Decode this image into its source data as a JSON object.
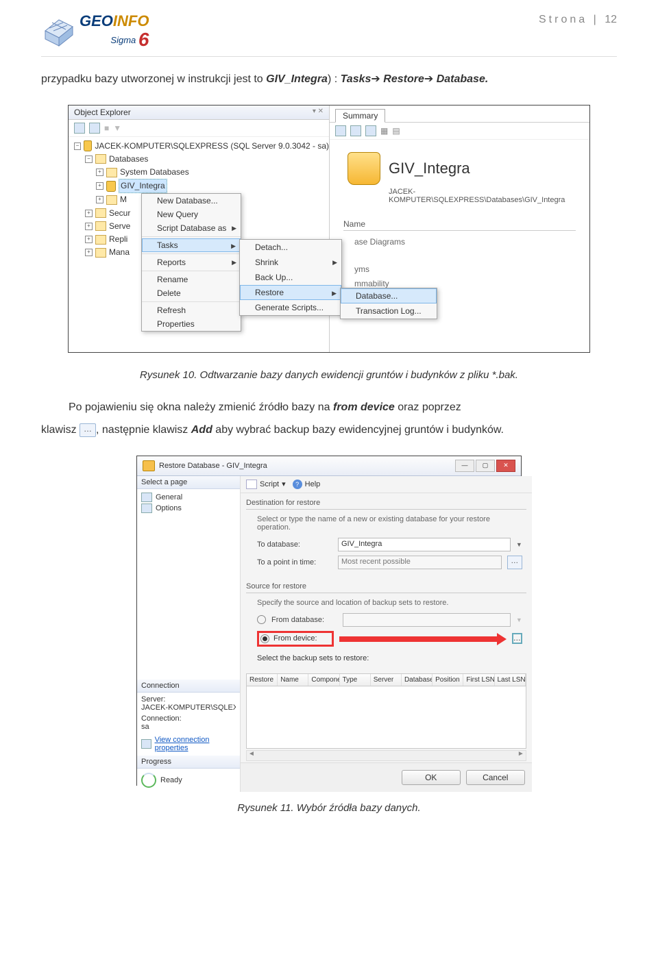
{
  "header": {
    "logo_geo": "GEO",
    "logo_info": "INFO",
    "logo_sigma": "Sigma",
    "logo_six": "6",
    "page_label": "Strona",
    "page_number": "12"
  },
  "para1_a": "przypadku bazy utworzonej w instrukcji jest to ",
  "para1_b": "GIV_Integra",
  "para1_c": ") : ",
  "para1_tasks": "Tasks",
  "para1_restore": "Restore",
  "para1_db": "Database.",
  "fig1": {
    "oe_title": "Object Explorer",
    "pin": "▾ ✕",
    "server": "JACEK-KOMPUTER\\SQLEXPRESS (SQL Server 9.0.3042 - sa)",
    "databases": "Databases",
    "sys_db": "System Databases",
    "giv": "GIV_Integra",
    "folders": [
      "M",
      "Secur",
      "Serve",
      "Repli",
      "Mana"
    ],
    "menu1": [
      "New Database...",
      "New Query",
      "Script Database as",
      "Tasks",
      "Reports",
      "Rename",
      "Delete",
      "Refresh",
      "Properties"
    ],
    "menu2": [
      "Detach...",
      "Shrink",
      "Back Up...",
      "Restore",
      "Generate Scripts..."
    ],
    "menu3": [
      "Database...",
      "Transaction Log..."
    ],
    "summary": "Summary",
    "big_title": "GIV_Integra",
    "big_path": "JACEK-KOMPUTER\\SQLEXPRESS\\Databases\\GIV_Integra",
    "name": "Name",
    "frags": [
      "ase Diagrams",
      "yms",
      "mmability"
    ]
  },
  "caption1": "Rysunek 10. Odtwarzanie bazy danych ewidencji gruntów i budynków z pliku *.bak.",
  "para2_a": "Po pojawieniu się okna należy zmienić źródło bazy na ",
  "para2_b": "from device",
  "para2_c": " oraz poprzez",
  "para3_a": "klawisz ",
  "para3_b": ", następnie klawisz ",
  "para3_c": "Add",
  "para3_d": " aby wybrać backup bazy ewidencyjnej gruntów i budynków.",
  "fig2": {
    "title": "Restore Database - GIV_Integra",
    "select_page": "Select a page",
    "pages": [
      "General",
      "Options"
    ],
    "script": "Script",
    "help": "Help",
    "dest_group": "Destination for restore",
    "dest_hint": "Select or type the name of a new or existing database for your restore operation.",
    "to_db": "To database:",
    "to_db_val": "GIV_Integra",
    "to_point": "To a point in time:",
    "to_point_val": "Most recent possible",
    "src_group": "Source for restore",
    "src_hint": "Specify the source and location of backup sets to restore.",
    "from_db": "From database:",
    "from_dev": "From device:",
    "sel_backup": "Select the backup sets to restore:",
    "cols": [
      "Restore",
      "Name",
      "Component",
      "Type",
      "Server",
      "Database",
      "Position",
      "First LSN",
      "Last LSN"
    ],
    "connection": "Connection",
    "server_lbl": "Server:",
    "server_val": "JACEK-KOMPUTER\\SQLEXPRE",
    "conn_lbl": "Connection:",
    "conn_val": "sa",
    "view_conn": "View connection properties",
    "progress": "Progress",
    "ready": "Ready",
    "ok": "OK",
    "cancel": "Cancel"
  },
  "caption2": "Rysunek 11. Wybór źródła bazy danych."
}
